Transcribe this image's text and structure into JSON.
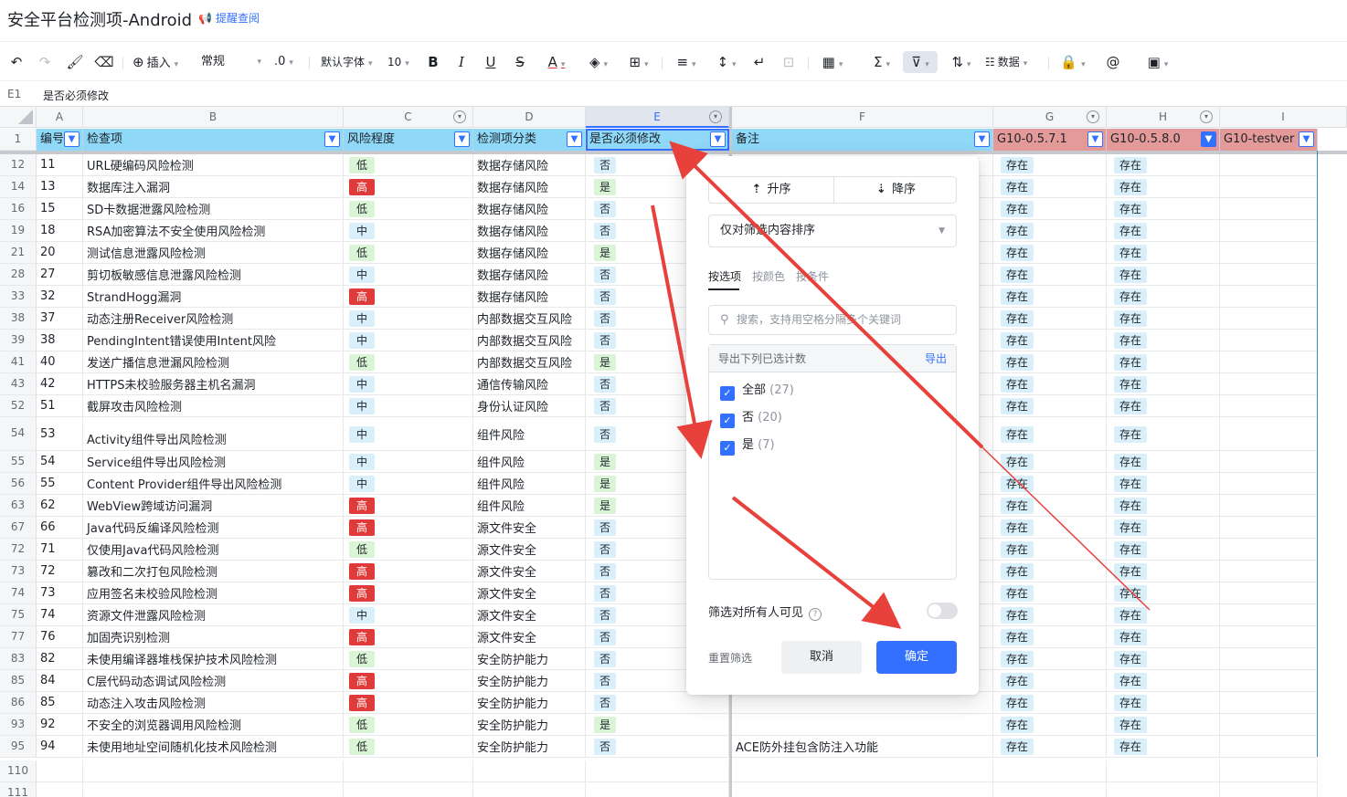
{
  "doc": {
    "title": "安全平台检测项-Android",
    "reminder": "提醒查阅"
  },
  "toolbar": {
    "insert": "插入",
    "format": "常规",
    "decimal": ".0",
    "font": "默认字体",
    "size": "10",
    "data": "数据"
  },
  "formula": {
    "ref": "E1",
    "content": "是否必须修改"
  },
  "columns": [
    "A",
    "B",
    "C",
    "D",
    "E",
    "F",
    "G",
    "H",
    "I"
  ],
  "header_row": {
    "num": "1",
    "cells": [
      "编号",
      "检查项",
      "风险程度",
      "检测项分类",
      "是否必须修改",
      "备注",
      "G10-0.5.7.1",
      "G10-0.5.8.0",
      "G10-testver"
    ]
  },
  "rows": [
    {
      "r": "12",
      "id": "11",
      "name": "URL硬编码风险检测",
      "risk": "低",
      "cat": "数据存储风险",
      "must": "否",
      "note": "",
      "g": "存在",
      "h": "存在"
    },
    {
      "r": "14",
      "id": "13",
      "name": "数据库注入漏洞",
      "risk": "高",
      "cat": "数据存储风险",
      "must": "是",
      "note": "",
      "g": "存在",
      "h": "存在"
    },
    {
      "r": "16",
      "id": "15",
      "name": "SD卡数据泄露风险检测",
      "risk": "低",
      "cat": "数据存储风险",
      "must": "否",
      "note": "",
      "g": "存在",
      "h": "存在"
    },
    {
      "r": "19",
      "id": "18",
      "name": "RSA加密算法不安全使用风险检测",
      "risk": "中",
      "cat": "数据存储风险",
      "must": "否",
      "note": "",
      "g": "存在",
      "h": "存在"
    },
    {
      "r": "21",
      "id": "20",
      "name": "测试信息泄露风险检测",
      "risk": "低",
      "cat": "数据存储风险",
      "must": "是",
      "note": "",
      "g": "存在",
      "h": "存在"
    },
    {
      "r": "28",
      "id": "27",
      "name": "剪切板敏感信息泄露风险检测",
      "risk": "中",
      "cat": "数据存储风险",
      "must": "否",
      "note": "",
      "g": "存在",
      "h": "存在"
    },
    {
      "r": "33",
      "id": "32",
      "name": "StrandHogg漏洞",
      "risk": "高",
      "cat": "数据存储风险",
      "must": "否",
      "note": "",
      "g": "存在",
      "h": "存在"
    },
    {
      "r": "38",
      "id": "37",
      "name": "动态注册Receiver风险检测",
      "risk": "中",
      "cat": "内部数据交互风险",
      "must": "否",
      "note": "",
      "g": "存在",
      "h": "存在"
    },
    {
      "r": "39",
      "id": "38",
      "name": "PendingIntent错误使用Intent风险",
      "risk": "中",
      "cat": "内部数据交互风险",
      "must": "否",
      "note": "",
      "g": "存在",
      "h": "存在"
    },
    {
      "r": "41",
      "id": "40",
      "name": "发送广播信息泄漏风险检测",
      "risk": "低",
      "cat": "内部数据交互风险",
      "must": "是",
      "note": "",
      "g": "存在",
      "h": "存在"
    },
    {
      "r": "43",
      "id": "42",
      "name": "HTTPS未校验服务器主机名漏洞",
      "risk": "中",
      "cat": "通信传输风险",
      "must": "否",
      "note": "",
      "g": "存在",
      "h": "存在"
    },
    {
      "r": "52",
      "id": "51",
      "name": "截屏攻击风险检测",
      "risk": "中",
      "cat": "身份认证风险",
      "must": "否",
      "note": "",
      "g": "存在",
      "h": "存在"
    },
    {
      "r": "54",
      "id": "53",
      "name": "Activity组件导出风险检测",
      "risk": "中",
      "cat": "组件风险",
      "must": "否",
      "note": "",
      "g": "存在",
      "h": "存在",
      "tall": true
    },
    {
      "r": "55",
      "id": "54",
      "name": "Service组件导出风险检测",
      "risk": "中",
      "cat": "组件风险",
      "must": "是",
      "note": "",
      "g": "存在",
      "h": "存在"
    },
    {
      "r": "56",
      "id": "55",
      "name": "Content Provider组件导出风险检测",
      "risk": "中",
      "cat": "组件风险",
      "must": "是",
      "note": "",
      "g": "存在",
      "h": "存在"
    },
    {
      "r": "63",
      "id": "62",
      "name": "WebView跨域访问漏洞",
      "risk": "高",
      "cat": "组件风险",
      "must": "是",
      "note": "",
      "g": "存在",
      "h": "存在"
    },
    {
      "r": "67",
      "id": "66",
      "name": "Java代码反编译风险检测",
      "risk": "高",
      "cat": "源文件安全",
      "must": "否",
      "note": "",
      "g": "存在",
      "h": "存在"
    },
    {
      "r": "72",
      "id": "71",
      "name": "仅使用Java代码风险检测",
      "risk": "低",
      "cat": "源文件安全",
      "must": "否",
      "note": "",
      "g": "存在",
      "h": "存在"
    },
    {
      "r": "73",
      "id": "72",
      "name": "篡改和二次打包风险检测",
      "risk": "高",
      "cat": "源文件安全",
      "must": "否",
      "note": "",
      "g": "存在",
      "h": "存在"
    },
    {
      "r": "74",
      "id": "73",
      "name": "应用签名未校验风险检测",
      "risk": "高",
      "cat": "源文件安全",
      "must": "否",
      "note": "",
      "g": "存在",
      "h": "存在"
    },
    {
      "r": "75",
      "id": "74",
      "name": "资源文件泄露风险检测",
      "risk": "中",
      "cat": "源文件安全",
      "must": "否",
      "note": "",
      "g": "存在",
      "h": "存在"
    },
    {
      "r": "77",
      "id": "76",
      "name": "加固壳识别检测",
      "risk": "高",
      "cat": "源文件安全",
      "must": "否",
      "note": "",
      "g": "存在",
      "h": "存在"
    },
    {
      "r": "83",
      "id": "82",
      "name": "未使用编译器堆栈保护技术风险检测",
      "risk": "低",
      "cat": "安全防护能力",
      "must": "否",
      "note": "",
      "g": "存在",
      "h": "存在"
    },
    {
      "r": "85",
      "id": "84",
      "name": "C层代码动态调试风险检测",
      "risk": "高",
      "cat": "安全防护能力",
      "must": "否",
      "note": "",
      "g": "存在",
      "h": "存在"
    },
    {
      "r": "86",
      "id": "85",
      "name": "动态注入攻击风险检测",
      "risk": "高",
      "cat": "安全防护能力",
      "must": "否",
      "note": "",
      "g": "存在",
      "h": "存在"
    },
    {
      "r": "93",
      "id": "92",
      "name": "不安全的浏览器调用风险检测",
      "risk": "低",
      "cat": "安全防护能力",
      "must": "是",
      "note": "",
      "g": "存在",
      "h": "存在"
    },
    {
      "r": "95",
      "id": "94",
      "name": "未使用地址空间随机化技术风险检测",
      "risk": "低",
      "cat": "安全防护能力",
      "must": "否",
      "note": "ACE防外挂包含防注入功能",
      "g": "存在",
      "h": "存在"
    }
  ],
  "empty_rows": [
    "110",
    "111"
  ],
  "filter_panel": {
    "sort_asc": "升序",
    "sort_desc": "降序",
    "sort_scope": "仅对筛选内容排序",
    "tab_value": "按选项",
    "tab_color": "按颜色",
    "tab_condition": "按条件",
    "search_placeholder": "搜索，支持用空格分隔多个关键词",
    "list_header": "导出下列已选计数",
    "export": "导出",
    "options": [
      {
        "label": "全部",
        "count": "(27)"
      },
      {
        "label": "否",
        "count": "(20)"
      },
      {
        "label": "是",
        "count": "(7)"
      }
    ],
    "visible_label": "筛选对所有人可见",
    "reset": "重置筛选",
    "cancel": "取消",
    "ok": "确定"
  },
  "colors": {
    "accent": "#3370ff",
    "header_blue": "#8fd8f8",
    "header_red": "#e59a9a",
    "risk_high": "#e03b3b",
    "arrow": "#e8413c"
  }
}
